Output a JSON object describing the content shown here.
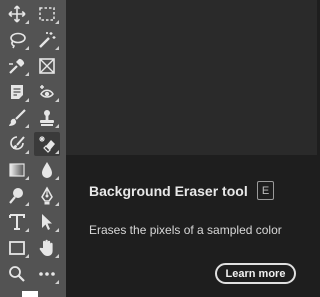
{
  "toolbar": {
    "tools": [
      {
        "name": "move-tool",
        "icon": "move-icon",
        "has_flyout": true
      },
      {
        "name": "rectangular-marquee-tool",
        "icon": "rect-marquee-icon",
        "has_flyout": true
      },
      {
        "name": "lasso-tool",
        "icon": "lasso-icon",
        "has_flyout": true
      },
      {
        "name": "magic-wand-tool",
        "icon": "magic-wand-icon",
        "has_flyout": true
      },
      {
        "name": "eyedropper-tool",
        "icon": "eyedropper-icon",
        "has_flyout": true
      },
      {
        "name": "frame-tool",
        "icon": "frame-icon",
        "has_flyout": false
      },
      {
        "name": "note-tool",
        "icon": "note-icon",
        "has_flyout": true
      },
      {
        "name": "red-eye-tool",
        "icon": "red-eye-icon",
        "has_flyout": true
      },
      {
        "name": "brush-tool",
        "icon": "brush-icon",
        "has_flyout": true
      },
      {
        "name": "clone-stamp-tool",
        "icon": "stamp-icon",
        "has_flyout": true
      },
      {
        "name": "history-brush-tool",
        "icon": "history-brush-icon",
        "has_flyout": true
      },
      {
        "name": "background-eraser-tool",
        "icon": "background-eraser-icon",
        "has_flyout": true,
        "active": true
      },
      {
        "name": "gradient-tool",
        "icon": "gradient-icon",
        "has_flyout": true
      },
      {
        "name": "blur-tool",
        "icon": "drop-icon",
        "has_flyout": true
      },
      {
        "name": "dodge-tool",
        "icon": "dodge-icon",
        "has_flyout": true
      },
      {
        "name": "pen-tool",
        "icon": "pen-icon",
        "has_flyout": true
      },
      {
        "name": "type-tool",
        "icon": "type-icon",
        "has_flyout": true
      },
      {
        "name": "path-selection-tool",
        "icon": "arrow-icon",
        "has_flyout": true
      },
      {
        "name": "rectangle-tool",
        "icon": "rectangle-icon",
        "has_flyout": true
      },
      {
        "name": "hand-tool",
        "icon": "hand-icon",
        "has_flyout": true
      },
      {
        "name": "zoom-tool",
        "icon": "zoom-icon",
        "has_flyout": false
      },
      {
        "name": "edit-toolbar",
        "icon": "more-icon",
        "has_flyout": true
      }
    ],
    "colors": {
      "background": "#535353",
      "icon": "#e6e6e6",
      "foreground_swatch": "#ffffff"
    }
  },
  "tooltip": {
    "title": "Background Eraser tool",
    "shortcut": "E",
    "description": "Erases the pixels of a sampled color",
    "learn_more_label": "Learn more"
  }
}
